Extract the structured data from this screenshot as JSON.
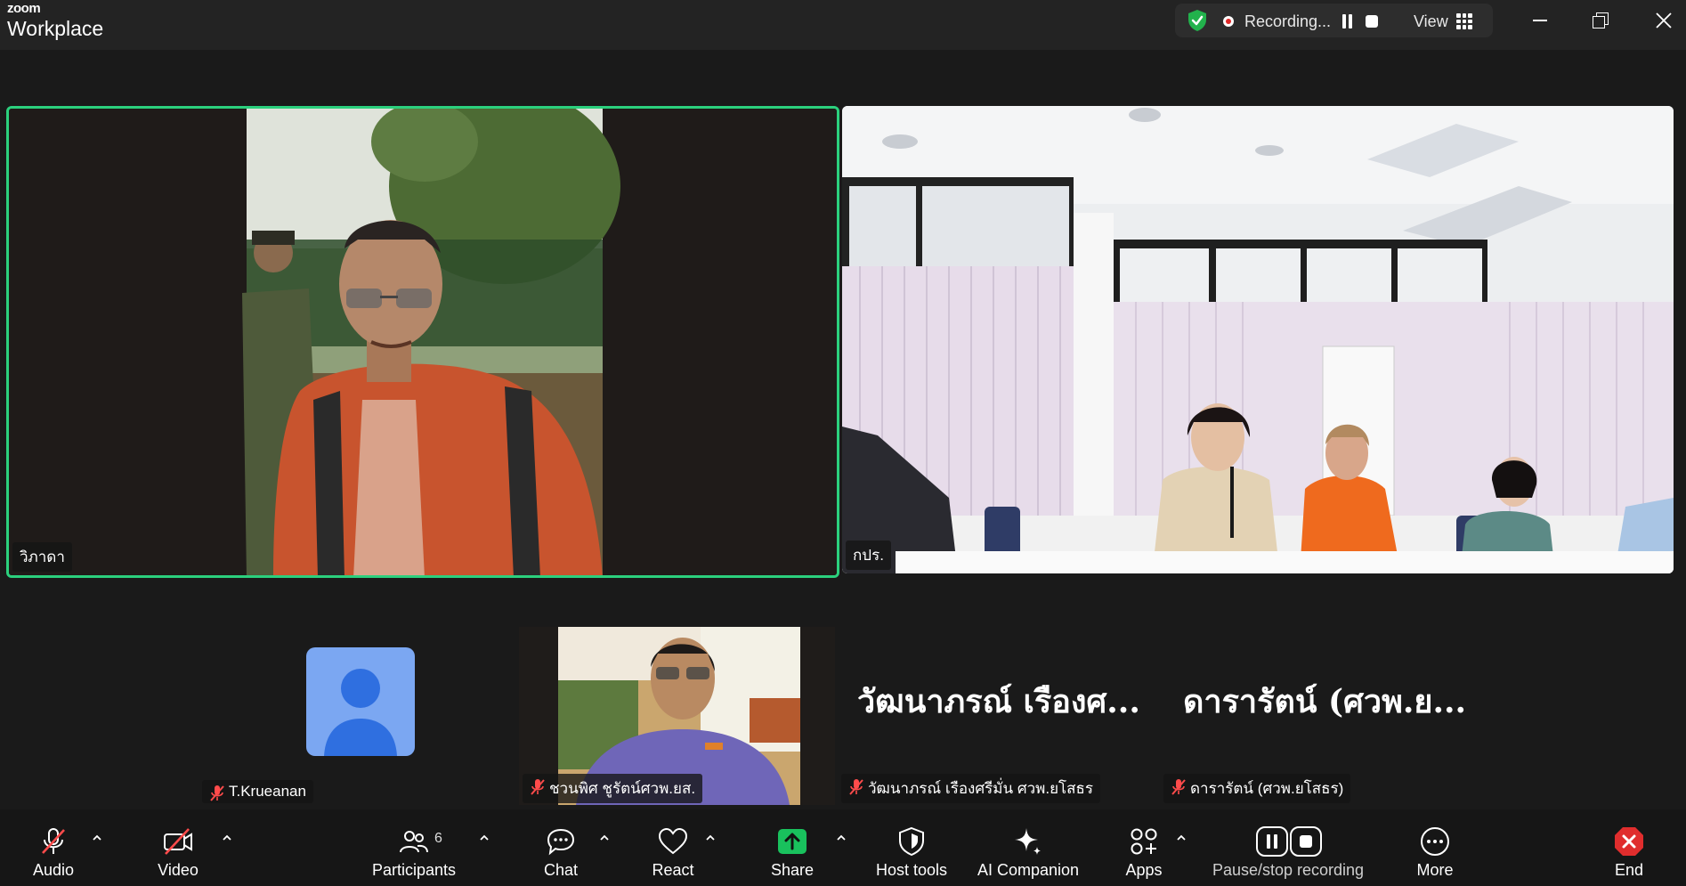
{
  "app": {
    "brand_small": "zoom",
    "brand_large": "Workplace"
  },
  "recording": {
    "status_text": "Recording...",
    "view_label": "View"
  },
  "participants": [
    {
      "name": "วิภาดา",
      "active_speaker": true
    },
    {
      "name": "กปร."
    },
    {
      "name": "T.Krueanan",
      "muted": true
    },
    {
      "name": "ชวนพิศ ชูรัตน์ศวพ.ยส.",
      "muted": true
    },
    {
      "name": "วัฒนาภรณ์  เรืองศรีมั่น ศวพ.ยโสธร",
      "display_name": "วัฒนาภรณ์  เรืองศ...",
      "muted": true
    },
    {
      "name": "ดารารัตน์ (ศวพ.ยโสธร)",
      "display_name": "ดารารัตน์ (ศวพ.ย...",
      "muted": true
    }
  ],
  "toolbar": {
    "audio": "Audio",
    "video": "Video",
    "participants": "Participants",
    "participants_count": "6",
    "chat": "Chat",
    "react": "React",
    "share": "Share",
    "host_tools": "Host tools",
    "ai_companion": "AI Companion",
    "apps": "Apps",
    "pause_stop": "Pause/stop recording",
    "more": "More",
    "end": "End"
  },
  "colors": {
    "active_border": "#2bd07d",
    "share_green": "#19c15d",
    "end_red": "#e02d2d",
    "avatar_blue": "#7ba7f2"
  }
}
